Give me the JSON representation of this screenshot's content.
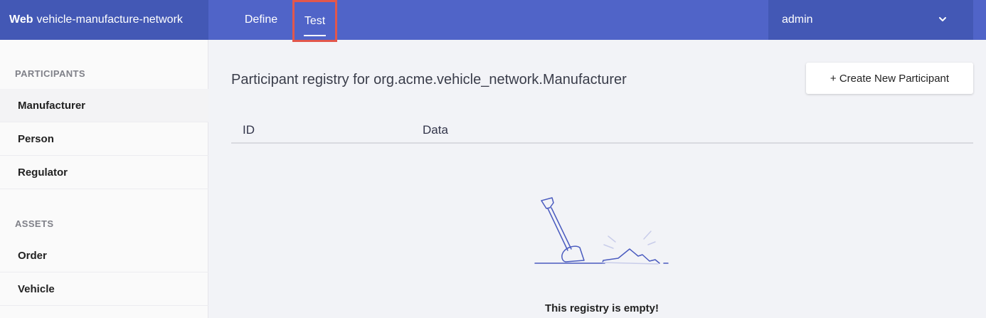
{
  "header": {
    "brand_bold": "Web",
    "brand_name": "vehicle-manufacture-network",
    "tabs": [
      {
        "label": "Define"
      },
      {
        "label": "Test"
      }
    ],
    "user": "admin"
  },
  "sidebar": {
    "participants_title": "PARTICIPANTS",
    "participants": [
      {
        "label": "Manufacturer"
      },
      {
        "label": "Person"
      },
      {
        "label": "Regulator"
      }
    ],
    "assets_title": "ASSETS",
    "assets": [
      {
        "label": "Order"
      },
      {
        "label": "Vehicle"
      }
    ]
  },
  "main": {
    "title": "Participant registry for org.acme.vehicle_network.Manufacturer",
    "create_button": "+ Create New Participant",
    "columns": [
      "ID",
      "Data"
    ],
    "empty_message": "This registry is empty!"
  },
  "colors": {
    "topbar": "#5064c8",
    "topbar_dark": "#4358b5",
    "highlight": "#e2574c",
    "illustration": "#4a5bbf"
  },
  "icons": [
    "chevron-down-icon",
    "shovel-illustration"
  ]
}
